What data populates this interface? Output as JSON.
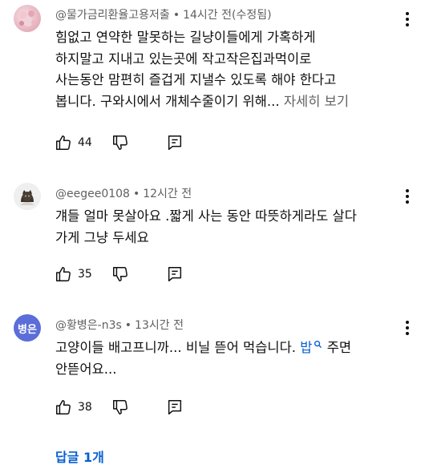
{
  "comments": [
    {
      "author": "@물가금리환율고용저출",
      "time": "14시간 전(수정됨)",
      "lines": [
        "힘없고 연약한  말못하는  길냥이들에게 가혹하게",
        "하지말고 지내고 있는곳에  작고작은집과먹이로",
        "사는동안 맘편히 즐겁게 지낼수 있도록 해야 한다고",
        "봅니다. 구와시에서 개체수줄이기  위해..."
      ],
      "more_label": "자세히 보기",
      "likes": "44"
    },
    {
      "author": "@eegee0108",
      "time": "12시간 전",
      "lines": [
        "걔들 얼마 못살아요 .짧게 사는 동안 따뜻하게라도 살다",
        "가게 그냥 두세요"
      ],
      "likes": "35"
    },
    {
      "author": "@황병은-n3s",
      "time": "13시간 전",
      "avatar_text": "병은",
      "line1_text": "고양이들 배고프니까... 비닐 뜯어 먹습니다. ",
      "line1_link": "밥",
      "line1_after": " 주면",
      "line2": "안뜯어요...",
      "likes": "38"
    }
  ],
  "replies_label": "답글 1개",
  "meta_separator": "•",
  "icons": {
    "like": "thumbs-up-icon",
    "dislike": "thumbs-down-icon",
    "reply": "reply-comment-icon",
    "menu": "more-vert-icon",
    "search": "search-icon"
  },
  "colors": {
    "text": "#0f0f0f",
    "secondary": "#606060",
    "link": "#065fd4",
    "avatar3_bg": "#5b6dd8"
  }
}
